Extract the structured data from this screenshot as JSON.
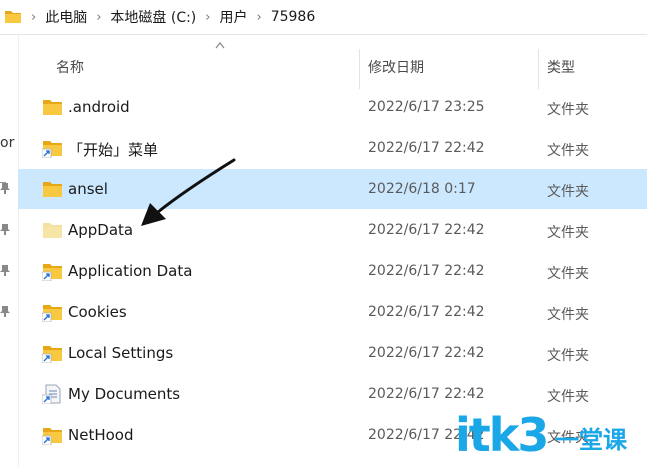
{
  "breadcrumb": {
    "items": [
      "此电脑",
      "本地磁盘 (C:)",
      "用户",
      "75986"
    ]
  },
  "leftnav": {
    "fragment": "or"
  },
  "columns": {
    "name": "名称",
    "date": "修改日期",
    "type": "类型"
  },
  "rows": [
    {
      "name": ".android",
      "date": "2022/6/17 23:25",
      "type": "文件夹",
      "icon": "folder-icon"
    },
    {
      "name": "「开始」菜单",
      "date": "2022/6/17 22:42",
      "type": "文件夹",
      "icon": "shortcut-folder-icon"
    },
    {
      "name": "ansel",
      "date": "2022/6/18 0:17",
      "type": "文件夹",
      "icon": "folder-icon"
    },
    {
      "name": "AppData",
      "date": "2022/6/17 22:42",
      "type": "文件夹",
      "icon": "hidden-folder-icon"
    },
    {
      "name": "Application Data",
      "date": "2022/6/17 22:42",
      "type": "文件夹",
      "icon": "shortcut-folder-icon"
    },
    {
      "name": "Cookies",
      "date": "2022/6/17 22:42",
      "type": "文件夹",
      "icon": "shortcut-folder-icon"
    },
    {
      "name": "Local Settings",
      "date": "2022/6/17 22:42",
      "type": "文件夹",
      "icon": "shortcut-folder-icon"
    },
    {
      "name": "My Documents",
      "date": "2022/6/17 22:42",
      "type": "文件夹",
      "icon": "shortcut-document-icon"
    },
    {
      "name": "NetHood",
      "date": "2022/6/17 22:42",
      "type": "文件夹",
      "icon": "shortcut-folder-icon"
    }
  ],
  "selected_row": 2,
  "watermark": {
    "logo": "itk3",
    "tagline": "一堂课"
  },
  "colors": {
    "folder": "#f8c840",
    "folder_dark": "#e6a817",
    "selection": "#cce8ff",
    "watermark": "#1aa7e8",
    "shortcut_arrow": "#1d6fd6"
  }
}
